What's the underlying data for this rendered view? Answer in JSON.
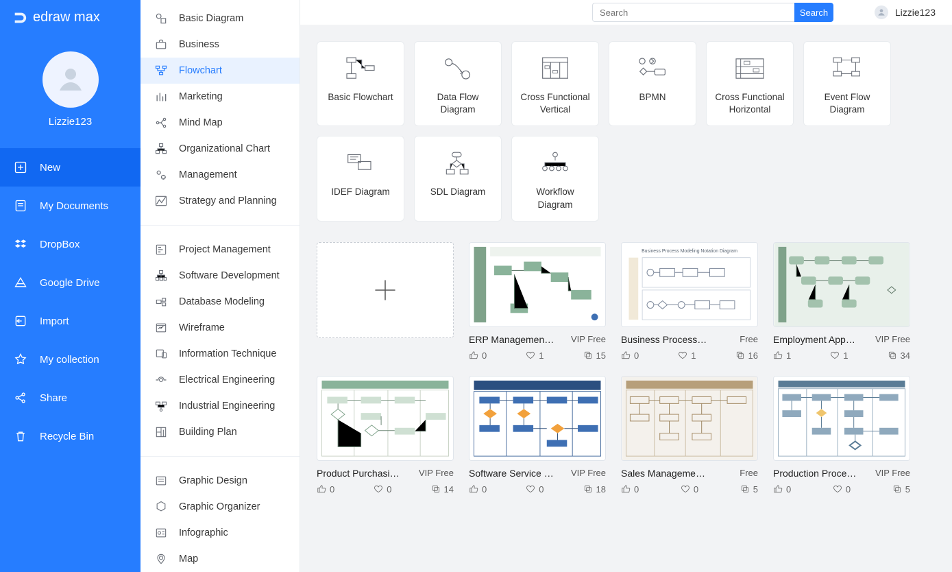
{
  "app": {
    "name": "edraw max"
  },
  "user": {
    "name": "Lizzie123"
  },
  "search": {
    "placeholder": "Search",
    "button": "Search"
  },
  "nav": {
    "items": [
      {
        "label": "New",
        "active": true
      },
      {
        "label": "My Documents"
      },
      {
        "label": "DropBox"
      },
      {
        "label": "Google Drive"
      },
      {
        "label": "Import"
      },
      {
        "label": "My collection"
      },
      {
        "label": "Share"
      },
      {
        "label": "Recycle Bin"
      }
    ]
  },
  "categories": {
    "groups": [
      [
        {
          "label": "Basic Diagram"
        },
        {
          "label": "Business"
        },
        {
          "label": "Flowchart",
          "active": true
        },
        {
          "label": "Marketing"
        },
        {
          "label": "Mind Map"
        },
        {
          "label": "Organizational Chart"
        },
        {
          "label": "Management"
        },
        {
          "label": "Strategy and Planning"
        }
      ],
      [
        {
          "label": "Project Management"
        },
        {
          "label": "Software Development"
        },
        {
          "label": "Database Modeling"
        },
        {
          "label": "Wireframe"
        },
        {
          "label": "Information Technique"
        },
        {
          "label": "Electrical Engineering"
        },
        {
          "label": "Industrial Engineering"
        },
        {
          "label": "Building Plan"
        }
      ],
      [
        {
          "label": "Graphic Design"
        },
        {
          "label": "Graphic Organizer"
        },
        {
          "label": "Infographic"
        },
        {
          "label": "Map"
        }
      ]
    ]
  },
  "subtypes": [
    {
      "label": "Basic Flowchart"
    },
    {
      "label": "Data Flow Diagram"
    },
    {
      "label": "Cross Functional Vertical"
    },
    {
      "label": "BPMN"
    },
    {
      "label": "Cross Functional Horizontal"
    },
    {
      "label": "Event Flow Diagram"
    },
    {
      "label": "IDEF Diagram"
    },
    {
      "label": "SDL Diagram"
    },
    {
      "label": "Workflow Diagram"
    }
  ],
  "templates": [
    {
      "blank": true
    },
    {
      "name": "ERP Managemen…",
      "badge": "VIP Free",
      "likes": 0,
      "favs": 1,
      "clones": 15
    },
    {
      "name": "Business Process Mo…",
      "badge": "Free",
      "likes": 0,
      "favs": 1,
      "clones": 16
    },
    {
      "name": "Employment App…",
      "badge": "VIP Free",
      "likes": 1,
      "favs": 1,
      "clones": 34
    },
    {
      "name": "Product Purchasi…",
      "badge": "VIP Free",
      "likes": 0,
      "favs": 0,
      "clones": 14
    },
    {
      "name": "Software Service …",
      "badge": "VIP Free",
      "likes": 0,
      "favs": 0,
      "clones": 18
    },
    {
      "name": "Sales Management C…",
      "badge": "Free",
      "likes": 0,
      "favs": 0,
      "clones": 5
    },
    {
      "name": "Production Proce…",
      "badge": "VIP Free",
      "likes": 0,
      "favs": 0,
      "clones": 5
    }
  ]
}
